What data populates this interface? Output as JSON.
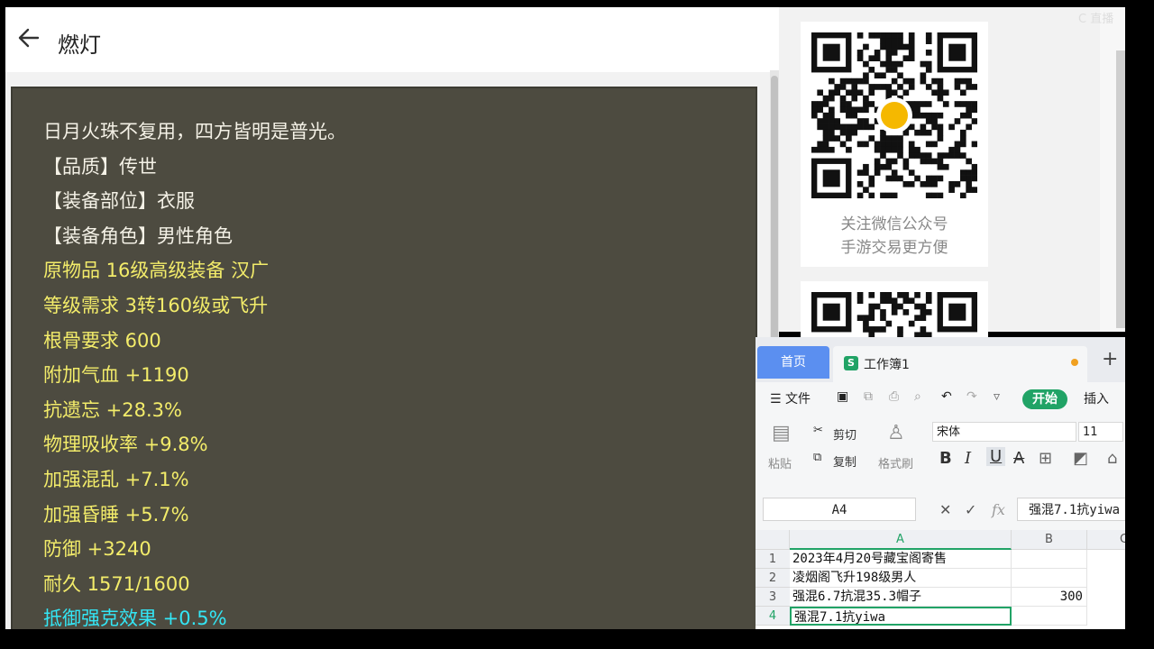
{
  "header": {
    "title": "燃灯"
  },
  "item": {
    "lines": [
      {
        "text": "日月火珠不复用，四方皆明是普光。",
        "color": "white"
      },
      {
        "text": "【品质】传世",
        "color": "white"
      },
      {
        "text": "【装备部位】衣服",
        "color": "white"
      },
      {
        "text": "【装备角色】男性角色",
        "color": "white"
      },
      {
        "text": "原物品 16级高级装备 汉广",
        "color": "yellow"
      },
      {
        "text": "等级需求 3转160级或飞升",
        "color": "yellow"
      },
      {
        "text": "根骨要求 600",
        "color": "yellow"
      },
      {
        "text": "附加气血 +1190",
        "color": "yellow"
      },
      {
        "text": "抗遗忘 +28.3%",
        "color": "yellow"
      },
      {
        "text": "物理吸收率 +9.8%",
        "color": "yellow"
      },
      {
        "text": "加强混乱 +7.1%",
        "color": "yellow"
      },
      {
        "text": "加强昏睡 +5.7%",
        "color": "yellow"
      },
      {
        "text": "防御 +3240",
        "color": "yellow"
      },
      {
        "text": "耐久 1571/1600",
        "color": "yellow"
      },
      {
        "text": "抵御强克效果 +0.5%",
        "color": "cyan"
      }
    ]
  },
  "qr": {
    "caption1": "关注微信公众号",
    "caption2": "手游交易更方便"
  },
  "watermark": "C 直播",
  "spreadsheet": {
    "tabs": {
      "home": "首页",
      "workbook": "工作簿1",
      "workbook_icon": "S",
      "add": "+"
    },
    "menu": {
      "file": "文件",
      "start": "开始",
      "insert": "插入"
    },
    "ribbon": {
      "cut": "剪切",
      "copy": "复制",
      "paste": "粘贴",
      "format_painter": "格式刷",
      "font": "宋体",
      "size": "11"
    },
    "name_box": "A4",
    "formula": "强混7.1抗yiwa",
    "columns": [
      "A",
      "B",
      "C"
    ],
    "rows": [
      {
        "num": "1",
        "a": "2023年4月20号藏宝阁寄售",
        "b": ""
      },
      {
        "num": "2",
        "a": "凌烟阁飞升198级男人",
        "b": ""
      },
      {
        "num": "3",
        "a": "强混6.7抗混35.3帽子",
        "b": "300"
      },
      {
        "num": "4",
        "a": "强混7.1抗yiwa",
        "b": ""
      }
    ]
  }
}
